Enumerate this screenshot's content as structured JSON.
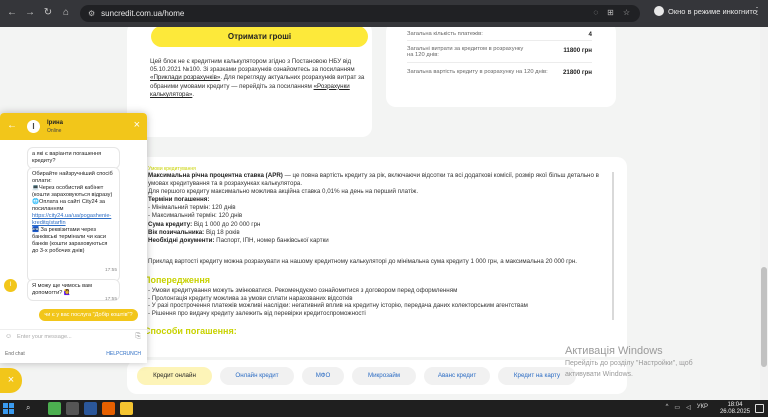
{
  "browser": {
    "url": "suncredit.com.ua/home",
    "incognito_label": "Окно в режиме инкогнито"
  },
  "top_card": {
    "cta_label": "Отримати гроші",
    "info_text_1": "Цей блок не є кредитним калькулятором згідно з Постановою НБУ від 05.10.2021 №100. Зі зразками розрахунків ознайомтесь за посиланням",
    "info_link_1": "«Приклади розрахунків»",
    "info_text_2": ". Для перегляду актуальних розрахунків витрат за обраними умовами кредиту — перейдіть за посиланням",
    "info_link_2": "«Розрахунки калькулятора»",
    "info_end": "."
  },
  "summary": {
    "rows": [
      {
        "label": "Загальна кількість платежів:",
        "value": "4"
      },
      {
        "label": "Загальні витрати за кредитом в розрахунку на 120 днів:",
        "value": "11800 грн"
      },
      {
        "label": "Загальна вартість кредиту в розрахунку на 120 днів:",
        "value": "21800 грн"
      }
    ]
  },
  "terms": {
    "section_label": "Умови кредитування",
    "apr_label": "Максимальна річна процентна ставка (APR)",
    "apr_text": " — це повна вартість кредиту за рік, включаючи відсотки та всі додаткові комісії, розмір якої більш детально в умовах кредитування та в розрахунках калькулятора.",
    "first_credit": "Для першого кредиту максимально можлива акційна ставка 0,01% на день на перший платіж.",
    "term_label": "Терміни погашення:",
    "term_min": "- Мінімальний термін: 120 днів",
    "term_max": "- Максимальний термін: 120 днів",
    "amount_label": "Сума кредиту:",
    "amount_value": " Від 1 000 до 20 000 грн",
    "age_label": "Вік позичальника:",
    "age_value": " Від 18 років",
    "docs_label": "Необхідні документи:",
    "docs_value": " Паспорт, ІПН, номер банківської картки"
  },
  "example_text": "Приклад вартості кредиту можна розрахувати на нашому кредитному калькуляторі до мінімальна сума кредиту 1 000 грн, а максимальна 20 000 грн.",
  "warnings": {
    "title": "Попередження",
    "items": [
      "- Умови кредитування можуть змінюватися. Рекомендуємо ознайомитися з договором перед оформленням",
      "- Пролонгація кредиту можлива за умови сплати нарахованих відсотків",
      "- У разі прострочення платежів можливі наслідки: негативний вплив на кредитну історію, передача даних колекторським агентствам",
      "- Рішення про видачу кредиту залежить від перевірки кредитоспроможності"
    ]
  },
  "payment_title": "Способи погашення:",
  "tabs": [
    {
      "label": "Кредит онлайн",
      "active": true
    },
    {
      "label": "Онлайн кредит",
      "active": false
    },
    {
      "label": "МФО",
      "active": false
    },
    {
      "label": "Микрозайм",
      "active": false
    },
    {
      "label": "Аванс кредит",
      "active": false
    },
    {
      "label": "Кредит на карту",
      "active": false
    }
  ],
  "activation": {
    "title": "Активація Windows",
    "line1": "Перейдіть до розділу \"Настройки\", щоб",
    "line2": "активувати Windows."
  },
  "chat": {
    "agent_name": "Ірина",
    "agent_status": "Online",
    "avatar_letter": "I",
    "messages": [
      {
        "text": "а які є варіанти погашення кредиту?"
      },
      {
        "text": "Обирайте найзручніший спосіб оплати:"
      },
      {
        "text": "💻Через особистий кабінет (кошти зараховуються відразу)"
      },
      {
        "text": "🌐Оплата на сайті City24 за посиланням"
      },
      {
        "link": "https://city24.ua/ua/pogashenie-kreditq/starfin"
      },
      {
        "text": "🏧 За реквізитами через банківські термінали чи каси банків (кошти зараховуються до 3-х робочих днів)"
      },
      {
        "time": "17:55"
      },
      {
        "text": "Я можу ще чимось вам допомогти? 🙋‍♀️"
      },
      {
        "time": "17:55"
      }
    ],
    "user_reply": "чи є у вас послуга \"Добір коштів\"?",
    "input_placeholder": "Enter your message...",
    "end_chat": "End chat",
    "powered": "HELPCRUNCH"
  },
  "taskbar": {
    "lang": "УКР",
    "time": "18:04",
    "date": "26.08.2025"
  },
  "colors": {
    "accent_yellow": "#f2c61a",
    "brand_lime": "#c8d200",
    "link_blue": "#2b6cc4"
  }
}
